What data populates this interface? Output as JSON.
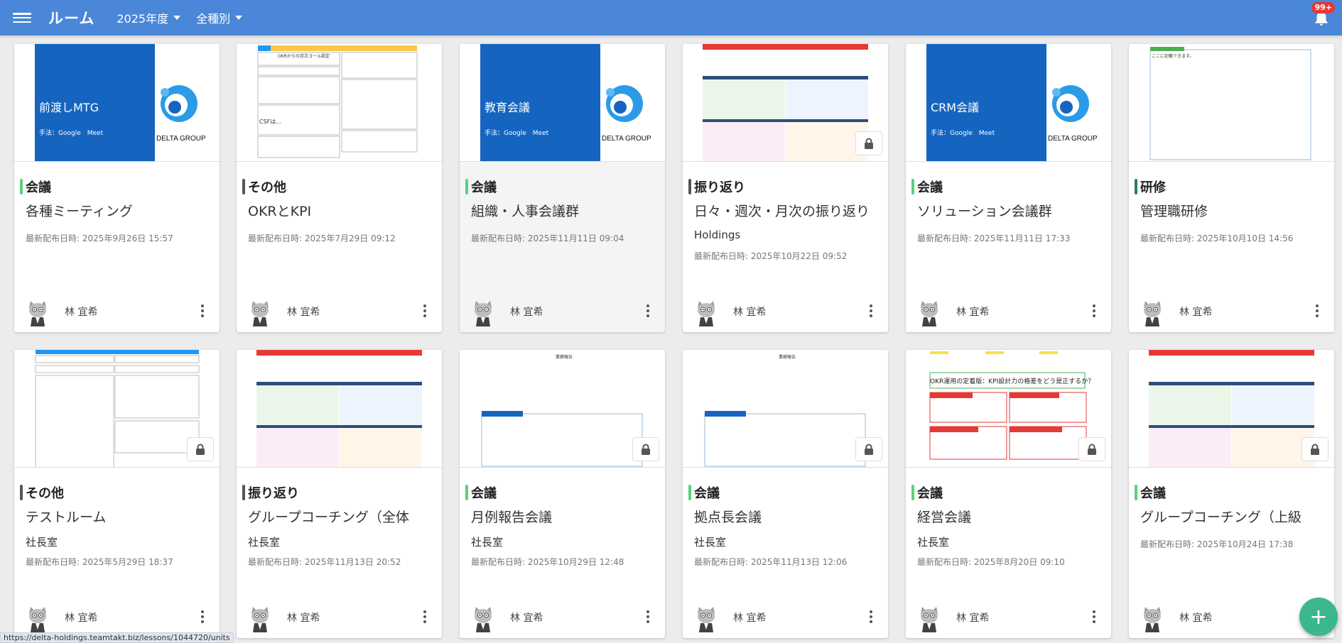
{
  "header": {
    "title": "ルーム",
    "year_filter": "2025年度",
    "type_filter": "全種別",
    "notification_badge": "99+"
  },
  "colors": {
    "header_bg": "#4a87d8",
    "meeting": "#5bd17a",
    "other": "#555555",
    "review": "#555555",
    "training": "#2e7d57",
    "fab": "#3bb78f"
  },
  "cards": [
    {
      "category": "会議",
      "title": "各種ミーティング",
      "org": "",
      "date": "最新配布日時: 2025年9月26日 15:57",
      "owner": "林 宜希",
      "thumb_title": "前渡しMTG",
      "thumb_sub": "手法：Google　Meet",
      "logo_text": "DELTA GROUP",
      "locked": false
    },
    {
      "category": "その他",
      "title": "OKRとKPI",
      "org": "",
      "date": "最新配布日時: 2025年7月29日 09:12",
      "owner": "林 宜希",
      "thumb_title": "OKRからの月次ゴール設定",
      "thumb_sub": "CSFは…",
      "locked": false
    },
    {
      "category": "会議",
      "title": "組織・人事会議群",
      "org": "",
      "date": "最新配布日時: 2025年11月11日 09:04",
      "owner": "林 宜希",
      "thumb_title": "教育会議",
      "thumb_sub": "手法：Google　Meet",
      "logo_text": "DELTA GROUP",
      "locked": false
    },
    {
      "category": "振り返り",
      "title": "日々・週次・月次の振り返り",
      "org": "Holdings",
      "date": "最新配布日時: 2025年10月22日 09:52",
      "owner": "林 宜希",
      "locked": true
    },
    {
      "category": "会議",
      "title": "ソリューション会議群",
      "org": "",
      "date": "最新配布日時: 2025年11月11日 17:33",
      "owner": "林 宜希",
      "thumb_title": "CRM会議",
      "thumb_sub": "手法：Google　Meet",
      "logo_text": "DELTA GROUP",
      "locked": false
    },
    {
      "category": "研修",
      "title": "管理職研修",
      "org": "",
      "date": "最新配布日時: 2025年10月10日 14:56",
      "owner": "林 宜希",
      "thumb_sub": "ここに記載できます。",
      "locked": false
    },
    {
      "category": "その他",
      "title": "テストルーム",
      "org": "社長室",
      "date": "最新配布日時: 2025年5月29日 18:37",
      "owner": "林 宜希",
      "locked": true
    },
    {
      "category": "振り返り",
      "title": "グループコーチング（全体",
      "org": "社長室",
      "date": "最新配布日時: 2025年11月13日 20:52",
      "owner": "林 宜希",
      "locked": false
    },
    {
      "category": "会議",
      "title": "月例報告会議",
      "org": "社長室",
      "date": "最新配布日時: 2025年10月29日 12:48",
      "owner": "林 宜希",
      "thumb_title": "業績報告",
      "locked": true
    },
    {
      "category": "会議",
      "title": "拠点長会議",
      "org": "社長室",
      "date": "最新配布日時: 2025年11月13日 12:06",
      "owner": "林 宜希",
      "thumb_title": "業績報告",
      "locked": true
    },
    {
      "category": "会議",
      "title": "経営会議",
      "org": "社長室",
      "date": "最新配布日時: 2025年8月20日 09:10",
      "owner": "林 宜希",
      "thumb_title": "OKR運用の定着版：KPI設計力の格差をどう是正するか？",
      "locked": true
    },
    {
      "category": "会議",
      "title": "グループコーチング（上級",
      "org": "",
      "date": "最新配布日時: 2025年10月24日 17:38",
      "owner": "林 宜希",
      "locked": true
    }
  ],
  "fab_label": "+",
  "status_url": "https://delta-holdings.teamtakt.biz/lessons/1044720/units"
}
